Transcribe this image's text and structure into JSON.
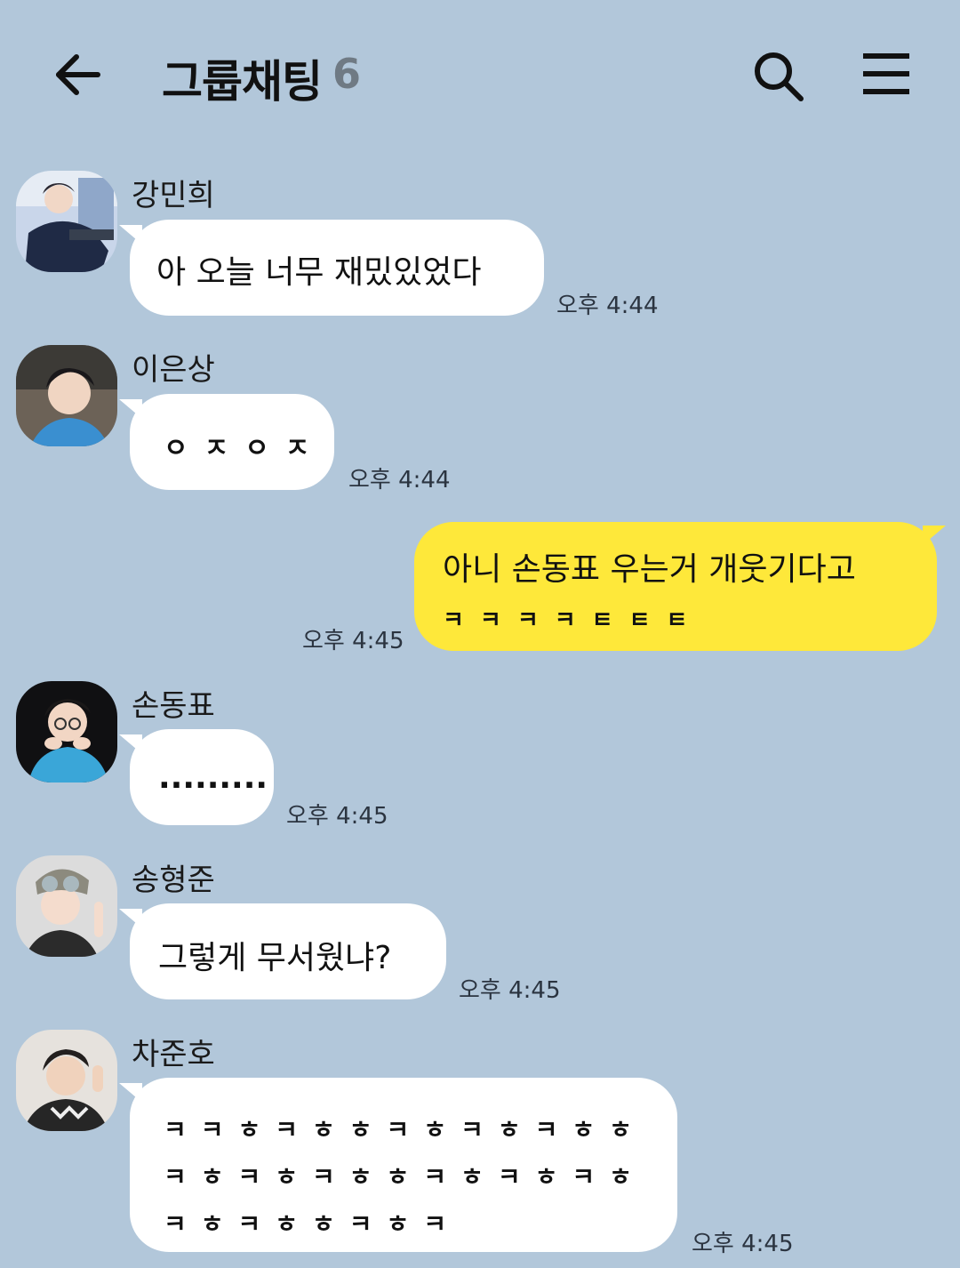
{
  "header": {
    "title": "그룹채팅",
    "member_count": "6"
  },
  "messages": [
    {
      "sender": "강민희",
      "text": "아 오늘 너무 재밌있었다",
      "time": "오후 4:44"
    },
    {
      "sender": "이은상",
      "text": "ㅇㅈㅇㅈ",
      "time": "오후 4:44"
    },
    {
      "sender": "",
      "text": "아니 손동표 우는거 개웃기다고",
      "text2": "ㅋㅋㅋㅋㅌㅌㅌ",
      "time": "오후 4:45"
    },
    {
      "sender": "손동표",
      "text": ".........",
      "time": "오후 4:45"
    },
    {
      "sender": "송형준",
      "text": "그렇게 무서웠냐?",
      "time": "오후 4:45"
    },
    {
      "sender": "차준호",
      "lines": [
        "ㅋㅋㅎㅋㅎㅎㅋㅎㅋㅎㅋㅎㅎ",
        "ㅋㅎㅋㅎㅋㅎㅎㅋㅎㅋㅎㅋㅎ",
        "ㅋㅎㅋㅎㅎㅋㅎㅋ"
      ],
      "time": "오후 4:45"
    }
  ],
  "colors": {
    "background": "#b2c7da",
    "my_bubble": "#fee83a",
    "other_bubble": "#ffffff"
  },
  "icons": [
    "back-arrow-icon",
    "search-icon",
    "menu-icon"
  ]
}
